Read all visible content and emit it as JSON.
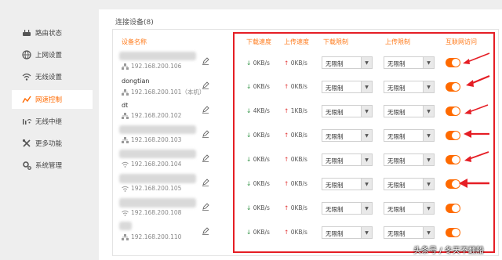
{
  "sidebar": {
    "items": [
      {
        "label": "路由状态",
        "icon": "router-icon"
      },
      {
        "label": "上网设置",
        "icon": "globe-icon"
      },
      {
        "label": "无线设置",
        "icon": "wifi-icon"
      },
      {
        "label": "网速控制",
        "icon": "speed-chart-icon"
      },
      {
        "label": "无线中继",
        "icon": "relay-icon"
      },
      {
        "label": "更多功能",
        "icon": "tools-icon"
      },
      {
        "label": "系统管理",
        "icon": "gear-icon"
      }
    ],
    "active_index": 3
  },
  "main": {
    "title": "连接设备(8)",
    "columns": {
      "device": "设备名称",
      "download_speed": "下载速度",
      "upload_speed": "上传速度",
      "download_limit": "下载限制",
      "upload_limit": "上传限制",
      "internet_access": "互联网访问"
    },
    "devices": [
      {
        "name": "",
        "ip": "192.168.200.106",
        "dl": "0KB/s",
        "ul": "0KB/s",
        "dl_limit": "无限制",
        "ul_limit": "无限制",
        "access": true,
        "conn": "wired"
      },
      {
        "name": "dongtian",
        "ip": "192.168.200.101（本机）",
        "dl": "0KB/s",
        "ul": "0KB/s",
        "dl_limit": "无限制",
        "ul_limit": "无限制",
        "access": true,
        "conn": "wired"
      },
      {
        "name": "dt",
        "ip": "192.168.200.102",
        "dl": "4KB/s",
        "ul": "1KB/s",
        "dl_limit": "无限制",
        "ul_limit": "无限制",
        "access": true,
        "conn": "wired"
      },
      {
        "name": "",
        "ip": "192.168.200.103",
        "dl": "0KB/s",
        "ul": "0KB/s",
        "dl_limit": "无限制",
        "ul_limit": "无限制",
        "access": true,
        "conn": "wired"
      },
      {
        "name": "",
        "ip": "192.168.200.104",
        "dl": "0KB/s",
        "ul": "0KB/s",
        "dl_limit": "无限制",
        "ul_limit": "无限制",
        "access": true,
        "conn": "wifi"
      },
      {
        "name": "",
        "ip": "192.168.200.105",
        "dl": "0KB/s",
        "ul": "0KB/s",
        "dl_limit": "无限制",
        "ul_limit": "无限制",
        "access": true,
        "conn": "wifi"
      },
      {
        "name": "",
        "ip": "192.168.200.108",
        "dl": "0KB/s",
        "ul": "0KB/s",
        "dl_limit": "无限制",
        "ul_limit": "无限制",
        "access": true,
        "conn": "wifi"
      },
      {
        "name": "",
        "ip": "192.168.200.110",
        "dl": "0KB/s",
        "ul": "0KB/s",
        "dl_limit": "无限制",
        "ul_limit": "无限制",
        "access": true,
        "conn": "wired"
      }
    ]
  },
  "colors": {
    "accent": "#ff6a00",
    "annotation_red": "#e51e25",
    "down_arrow": "#2a8f3e",
    "up_arrow": "#e23b3b"
  },
  "watermark": "头条号 / 冬天不翻船"
}
